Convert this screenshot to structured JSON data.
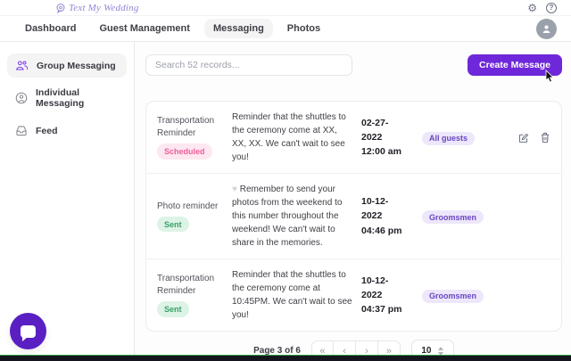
{
  "header": {
    "logo_text": "Text My Wedding",
    "gear_glyph": "⚙",
    "help_glyph": "?"
  },
  "nav": {
    "tabs": [
      {
        "label": "Dashboard",
        "active": false
      },
      {
        "label": "Guest Management",
        "active": false
      },
      {
        "label": "Messaging",
        "active": true
      },
      {
        "label": "Photos",
        "active": false
      }
    ]
  },
  "sidebar": {
    "items": [
      {
        "label": "Group Messaging",
        "icon": "group-icon",
        "active": true
      },
      {
        "label": "Individual Messaging",
        "icon": "person-icon",
        "active": false
      },
      {
        "label": "Feed",
        "icon": "feed-icon",
        "active": false
      }
    ]
  },
  "toolbar": {
    "search_placeholder": "Search 52 records...",
    "create_button_label": "Create Message"
  },
  "table": {
    "rows": [
      {
        "title": "Transportation Reminder",
        "status": "Scheduled",
        "message_prefix": "",
        "message": "Reminder that the shuttles to the ceremony come at XX, XX, XX. We can't wait to see you!",
        "datetime": "02-27-2022 12:00 am",
        "audience": "All guests"
      },
      {
        "title": "Photo reminder",
        "status": "Sent",
        "message_prefix": "♥ ",
        "message": "Remember to send your photos from the weekend to this number throughout the weekend! We can't wait to share in the memories.",
        "datetime": "10-12-2022 04:46 pm",
        "audience": "Groomsmen"
      },
      {
        "title": "Transportation Reminder",
        "status": "Sent",
        "message_prefix": "",
        "message": "Reminder that the shuttles to the ceremony come at 10:45PM. We can't wait to see you!",
        "datetime": "10-12-2022 04:37 pm",
        "audience": "Groomsmen"
      }
    ]
  },
  "pagination": {
    "label": "Page 3 of 6",
    "first_glyph": "«",
    "prev_glyph": "‹",
    "next_glyph": "›",
    "last_glyph": "»",
    "page_size": "10"
  },
  "colors": {
    "accent_purple": "#6e28d9",
    "chat_purple": "#5a1fc2",
    "logo_purple": "#9087d6",
    "badge_scheduled_bg": "#fde7f0",
    "badge_scheduled_text": "#ee5e99",
    "badge_sent_bg": "#ddf3e6",
    "badge_sent_text": "#38a169",
    "badge_audience_bg": "#ece7fa",
    "badge_audience_text": "#6b46c1"
  }
}
